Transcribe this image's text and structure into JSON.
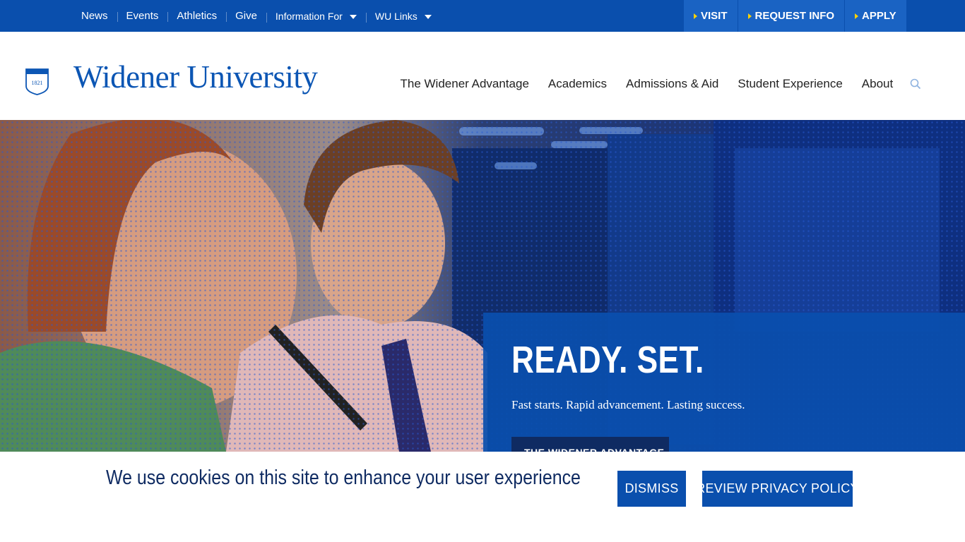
{
  "utility_nav": {
    "links": [
      "News",
      "Events",
      "Athletics",
      "Give"
    ],
    "dropdowns": [
      "Information For",
      "WU Links"
    ]
  },
  "cta": {
    "visit": "VISIT",
    "request_info": "REQUEST INFO",
    "apply": "APPLY"
  },
  "brand": {
    "name": "Widener University",
    "shield_year": "1821"
  },
  "main_nav": {
    "items": [
      "The Widener Advantage",
      "Academics",
      "Admissions & Aid",
      "Student Experience",
      "About"
    ]
  },
  "hero": {
    "headline": "READY. SET.",
    "subtitle": "Fast starts. Rapid advancement. Lasting success.",
    "button": "THE WIDENER ADVANTAGE"
  },
  "cookie": {
    "message": "We use cookies on this site to enhance your user experience",
    "dismiss": "DISMISS",
    "privacy": "REVIEW PRIVACY POLICY"
  },
  "colors": {
    "primary_blue": "#0a4fad",
    "cta_blue": "#1a63c3",
    "navy": "#0f2b62",
    "accent_yellow": "#ffd200"
  }
}
